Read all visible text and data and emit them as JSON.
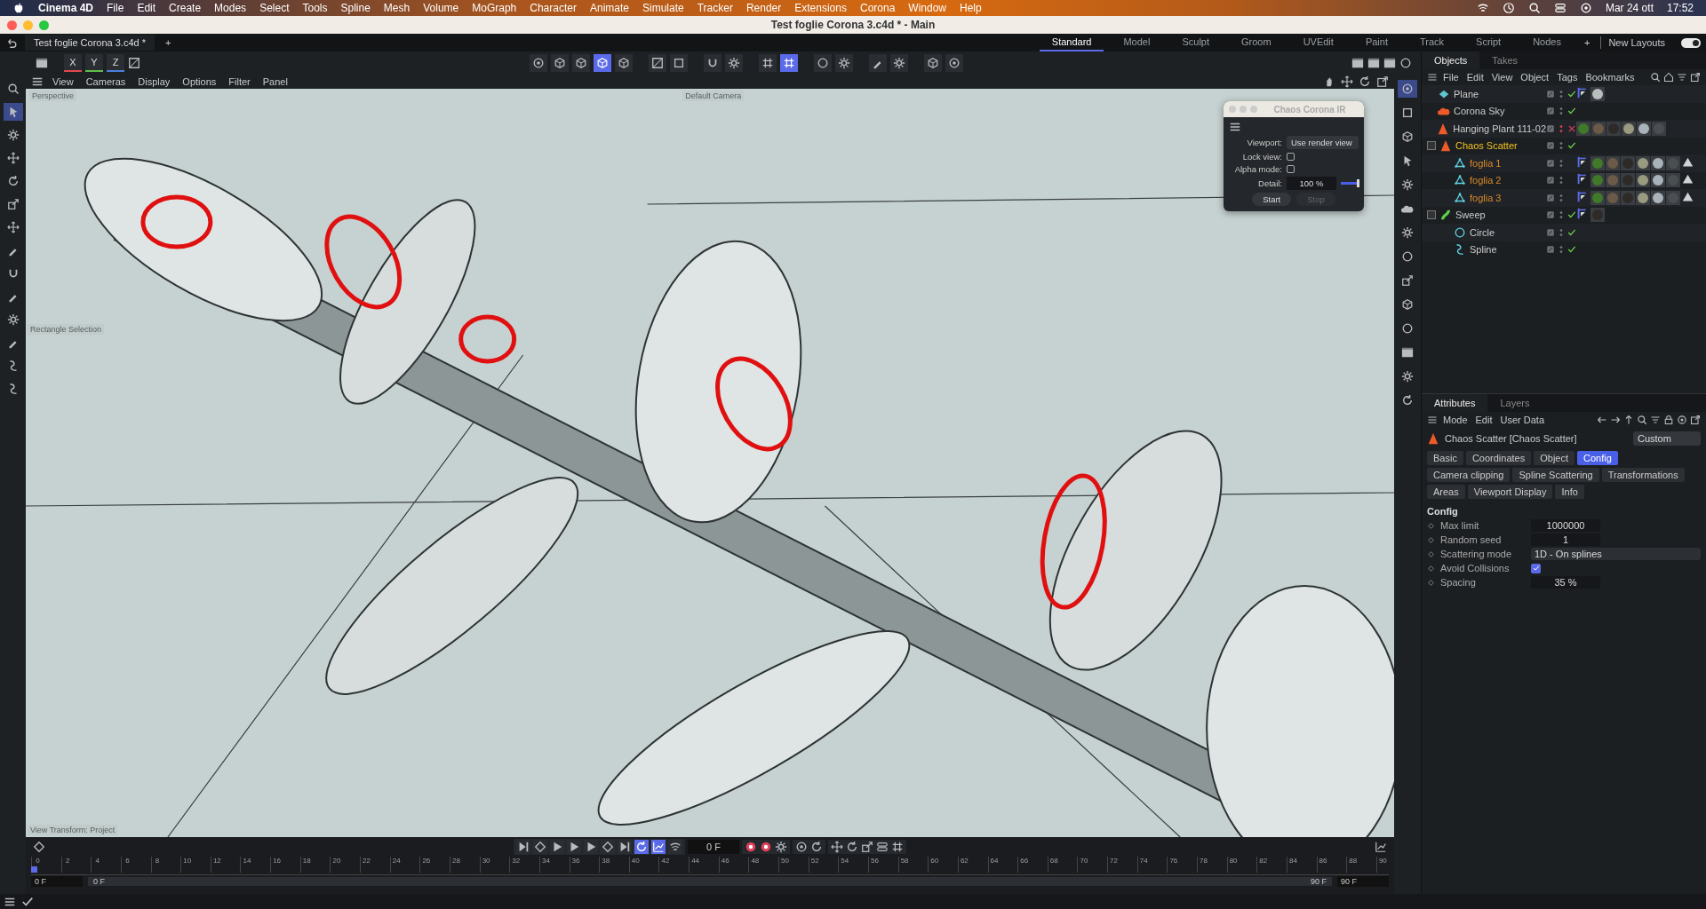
{
  "menubar": {
    "app": "Cinema 4D",
    "menus": [
      "File",
      "Edit",
      "Create",
      "Modes",
      "Select",
      "Tools",
      "Spline",
      "Mesh",
      "Volume",
      "MoGraph",
      "Character",
      "Animate",
      "Simulate",
      "Tracker",
      "Render",
      "Extensions",
      "Corona",
      "Window",
      "Help"
    ],
    "date": "Mar 24 ott",
    "time": "17:52"
  },
  "window": {
    "title": "Test foglie Corona 3.c4d * - Main"
  },
  "document_tabs": [
    {
      "label": "Test foglie Corona 3.c4d *",
      "selected": true
    }
  ],
  "new_tab": "+",
  "layouts": {
    "tabs": [
      {
        "label": "Standard",
        "selected": true
      },
      {
        "label": "Model",
        "selected": false
      },
      {
        "label": "Sculpt",
        "selected": false
      },
      {
        "label": "Groom",
        "selected": false
      },
      {
        "label": "UVEdit",
        "selected": false
      },
      {
        "label": "Paint",
        "selected": false
      },
      {
        "label": "Track",
        "selected": false
      },
      {
        "label": "Script",
        "selected": false
      },
      {
        "label": "Nodes",
        "selected": false
      }
    ],
    "add": "+",
    "new_layouts": "New Layouts",
    "new_layouts_on": true
  },
  "axis_buttons": [
    {
      "label": "X",
      "color": "#e0484f"
    },
    {
      "label": "Y",
      "color": "#5fbf4a"
    },
    {
      "label": "Z",
      "color": "#4a7fe0"
    }
  ],
  "toolbar_buttons": [
    {
      "selected": false
    },
    {
      "selected": false
    },
    {
      "selected": false
    },
    {
      "selected": true
    },
    {
      "selected": false
    },
    {
      "selected": false
    },
    {
      "selected": false
    },
    {
      "selected": false
    },
    {
      "selected": false
    },
    {
      "selected": false
    },
    {
      "selected": true
    },
    {
      "selected": false
    },
    {
      "selected": false
    },
    {
      "selected": false
    },
    {
      "selected": false
    },
    {
      "selected": false
    },
    {
      "selected": false
    }
  ],
  "tools": [
    {
      "selected": false
    },
    {
      "selected": true
    },
    {
      "selected": false
    },
    {
      "selected": false
    },
    {
      "selected": false
    },
    {
      "selected": false
    },
    {
      "selected": false
    },
    {
      "selected": false
    },
    {
      "selected": false
    },
    {
      "selected": false
    },
    {
      "selected": false
    },
    {
      "selected": false
    },
    {
      "selected": false
    },
    {
      "selected": false
    }
  ],
  "palette": [
    {
      "selected": true
    },
    {
      "selected": false
    },
    {
      "selected": false
    },
    {
      "selected": false
    },
    {
      "selected": false
    },
    {
      "selected": false
    },
    {
      "selected": false
    },
    {
      "selected": false
    },
    {
      "selected": false
    },
    {
      "selected": false
    },
    {
      "selected": false
    },
    {
      "selected": false
    },
    {
      "selected": false
    },
    {
      "selected": false
    }
  ],
  "viewport": {
    "menus": [
      "View",
      "Cameras",
      "Display",
      "Options",
      "Filter",
      "Panel"
    ],
    "view_name": "Perspective",
    "camera": "Default Camera",
    "tool": "Rectangle Selection",
    "transform": "View Transform: Project"
  },
  "corona_ir": {
    "title": "Chaos Corona IR",
    "viewport_label": "Viewport:",
    "viewport_value": "Use render view",
    "lock_view_label": "Lock view:",
    "lock_view": false,
    "alpha_mode_label": "Alpha mode:",
    "alpha_mode": false,
    "detail_label": "Detail:",
    "detail_value": "100 %",
    "detail_slider": {
      "level": 1
    },
    "start": "Start",
    "stop": "Stop",
    "stop_disabled": true
  },
  "objects_panel": {
    "tabs": [
      {
        "label": "Objects",
        "selected": true
      },
      {
        "label": "Takes",
        "selected": false
      }
    ],
    "menus": [
      "File",
      "Edit",
      "View",
      "Object",
      "Tags",
      "Bookmarks"
    ],
    "items": [
      {
        "name": "Plane",
        "kind": "plane",
        "selected": false,
        "highlighted": false,
        "hidden": false,
        "enabled": true,
        "tags": [
          {
            "kind": "display"
          },
          {
            "kind": "material",
            "color": "#b9bebe"
          }
        ]
      },
      {
        "name": "Corona Sky",
        "kind": "sky",
        "selected": false,
        "highlighted": false,
        "hidden": false,
        "enabled": true
      },
      {
        "name": "Hanging Plant 111-02",
        "kind": "plant",
        "selected": false,
        "highlighted": false,
        "hidden": true,
        "enabled": false,
        "tags": [
          {
            "kind": "material",
            "color": "#3f7a2a"
          },
          {
            "kind": "material",
            "color": "#6b5a48"
          },
          {
            "kind": "material",
            "color": "#2e2a27"
          },
          {
            "kind": "material",
            "color": "#9a9a80"
          },
          {
            "kind": "material",
            "color": "#a9b2b8"
          },
          {
            "kind": "material",
            "color": "#4a4f52"
          }
        ]
      },
      {
        "name": "Chaos Scatter",
        "kind": "scatter",
        "selected": true,
        "highlighted": false,
        "hidden": false,
        "enabled": true,
        "expanded": true,
        "children": [
          {
            "name": "foglia 1",
            "kind": "polygon",
            "selected": false,
            "highlighted": true,
            "hidden": false,
            "tags": [
              {
                "kind": "display"
              },
              {
                "kind": "material",
                "color": "#3f7a2a"
              },
              {
                "kind": "material",
                "color": "#6b5a48"
              },
              {
                "kind": "material",
                "color": "#2e2a27"
              },
              {
                "kind": "material",
                "color": "#9a9a80"
              },
              {
                "kind": "material",
                "color": "#a9b2b8"
              },
              {
                "kind": "material",
                "color": "#4a4f52"
              },
              {
                "kind": "selection"
              }
            ]
          },
          {
            "name": "foglia 2",
            "kind": "polygon",
            "selected": false,
            "highlighted": true,
            "hidden": false,
            "tags": [
              {
                "kind": "display"
              },
              {
                "kind": "material",
                "color": "#3f7a2a"
              },
              {
                "kind": "material",
                "color": "#6b5a48"
              },
              {
                "kind": "material",
                "color": "#2e2a27"
              },
              {
                "kind": "material",
                "color": "#9a9a80"
              },
              {
                "kind": "material",
                "color": "#a9b2b8"
              },
              {
                "kind": "material",
                "color": "#4a4f52"
              },
              {
                "kind": "selection"
              }
            ]
          },
          {
            "name": "foglia 3",
            "kind": "polygon",
            "selected": false,
            "highlighted": true,
            "hidden": false,
            "tags": [
              {
                "kind": "display"
              },
              {
                "kind": "material",
                "color": "#3f7a2a"
              },
              {
                "kind": "material",
                "color": "#6b5a48"
              },
              {
                "kind": "material",
                "color": "#2e2a27"
              },
              {
                "kind": "material",
                "color": "#9a9a80"
              },
              {
                "kind": "material",
                "color": "#a9b2b8"
              },
              {
                "kind": "material",
                "color": "#4a4f52"
              },
              {
                "kind": "selection"
              }
            ]
          }
        ]
      },
      {
        "name": "Sweep",
        "kind": "sweep",
        "selected": false,
        "highlighted": false,
        "hidden": false,
        "enabled": true,
        "expanded": true,
        "tags": [
          {
            "kind": "display"
          },
          {
            "kind": "material",
            "color": "#2e2a27"
          }
        ],
        "children": [
          {
            "name": "Circle",
            "kind": "circle",
            "selected": false,
            "highlighted": false,
            "hidden": false,
            "enabled": true
          },
          {
            "name": "Spline",
            "kind": "spline",
            "selected": false,
            "highlighted": false,
            "hidden": false,
            "enabled": true
          }
        ]
      }
    ]
  },
  "attributes": {
    "tabs": [
      {
        "label": "Attributes",
        "selected": true
      },
      {
        "label": "Layers",
        "selected": false
      }
    ],
    "menus": [
      "Mode",
      "Edit",
      "User Data"
    ],
    "object": "Chaos Scatter [Chaos Scatter]",
    "preset": "Custom",
    "groups": [
      {
        "label": "Basic",
        "selected": false
      },
      {
        "label": "Coordinates",
        "selected": false
      },
      {
        "label": "Object",
        "selected": false
      },
      {
        "label": "Config",
        "selected": true
      },
      {
        "label": "Camera clipping",
        "selected": false
      },
      {
        "label": "Spline Scattering",
        "selected": false
      },
      {
        "label": "Transformations",
        "selected": false
      },
      {
        "label": "Areas",
        "selected": false
      },
      {
        "label": "Viewport Display",
        "selected": false
      },
      {
        "label": "Info",
        "selected": false
      }
    ],
    "section": "Config",
    "fields": [
      {
        "kind": "number",
        "label": "Max limit",
        "value": "1000000"
      },
      {
        "kind": "number",
        "label": "Random seed",
        "value": "1"
      },
      {
        "kind": "dropdown",
        "label": "Scattering mode",
        "value": "1D - On splines"
      },
      {
        "kind": "checkbox",
        "label": "Avoid Collisions",
        "checked": true
      },
      {
        "kind": "number",
        "label": "Spacing",
        "value": "35 %"
      }
    ]
  },
  "timeline": {
    "transport": [
      {
        "selected": false
      },
      {
        "selected": false
      },
      {
        "selected": false
      },
      {
        "selected": false
      },
      {
        "selected": false
      },
      {
        "selected": false
      },
      {
        "selected": false
      },
      {
        "selected": true
      },
      {
        "selected": true
      },
      {
        "selected": false
      }
    ],
    "current_frame": "0 F",
    "ticks": [
      "0",
      "2",
      "4",
      "6",
      "8",
      "10",
      "12",
      "14",
      "16",
      "18",
      "20",
      "22",
      "24",
      "26",
      "28",
      "30",
      "32",
      "34",
      "36",
      "38",
      "40",
      "42",
      "44",
      "46",
      "48",
      "50",
      "52",
      "54",
      "56",
      "58",
      "60",
      "62",
      "64",
      "66",
      "68",
      "70",
      "72",
      "74",
      "76",
      "78",
      "80",
      "82",
      "84",
      "86",
      "88",
      "90"
    ],
    "playhead": {
      "level": 0
    },
    "start": "0 F",
    "preview_start": "0 F",
    "preview_end": "90 F",
    "end": "90 F"
  }
}
